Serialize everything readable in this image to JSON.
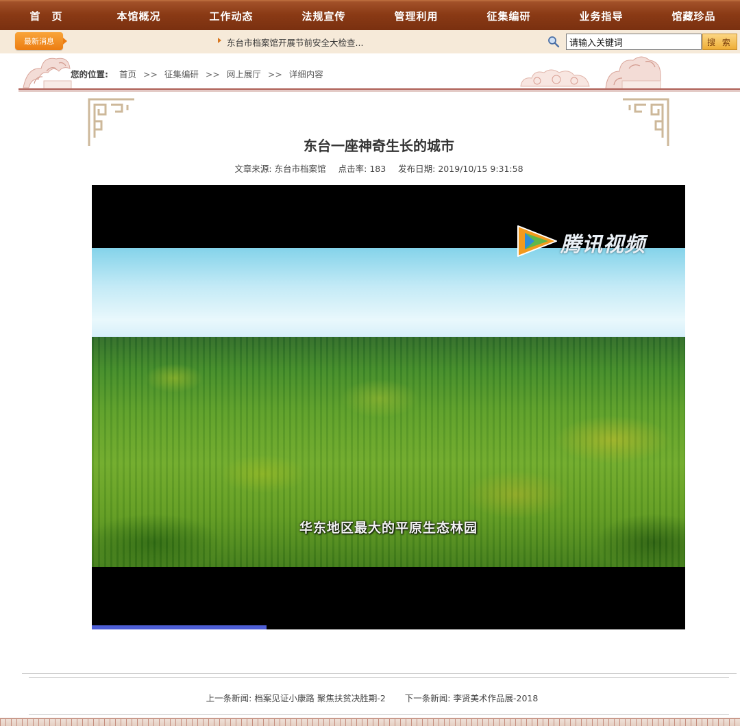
{
  "nav": {
    "items": [
      "首　页",
      "本馆概况",
      "工作动态",
      "法规宣传",
      "管理利用",
      "征集编研",
      "业务指导",
      "馆藏珍品"
    ]
  },
  "newsbar": {
    "badge": "最新消息",
    "headline": "东台市档案馆开展节前安全大检查..."
  },
  "search": {
    "value": "请输入关键词",
    "button": "搜 索"
  },
  "breadcrumb": {
    "label": "您的位置:",
    "items": [
      "首页",
      "征集编研",
      "网上展厅",
      "详细内容"
    ],
    "sep": ">>"
  },
  "article": {
    "title": "东台一座神奇生长的城市",
    "source_label": "文章来源:",
    "source": "东台市档案馆",
    "hits_label": "点击率:",
    "hits": "183",
    "date_label": "发布日期:",
    "date": "2019/10/15 9:31:58"
  },
  "video": {
    "watermark": "腾讯视频",
    "subtitle": "华东地区最大的平原生态林园",
    "progress": 0.295
  },
  "prevnext": {
    "prev_label": "上一条新闻:",
    "prev": "档案见证小康路 聚焦扶贫决胜期-2",
    "next_label": "下一条新闻:",
    "next": "李贤美术作品展-2018"
  },
  "colors": {
    "nav": "#8a3a15",
    "accent": "#ec7d12",
    "crumb_line": "#b46b62",
    "progress": "#4d5ed6"
  }
}
